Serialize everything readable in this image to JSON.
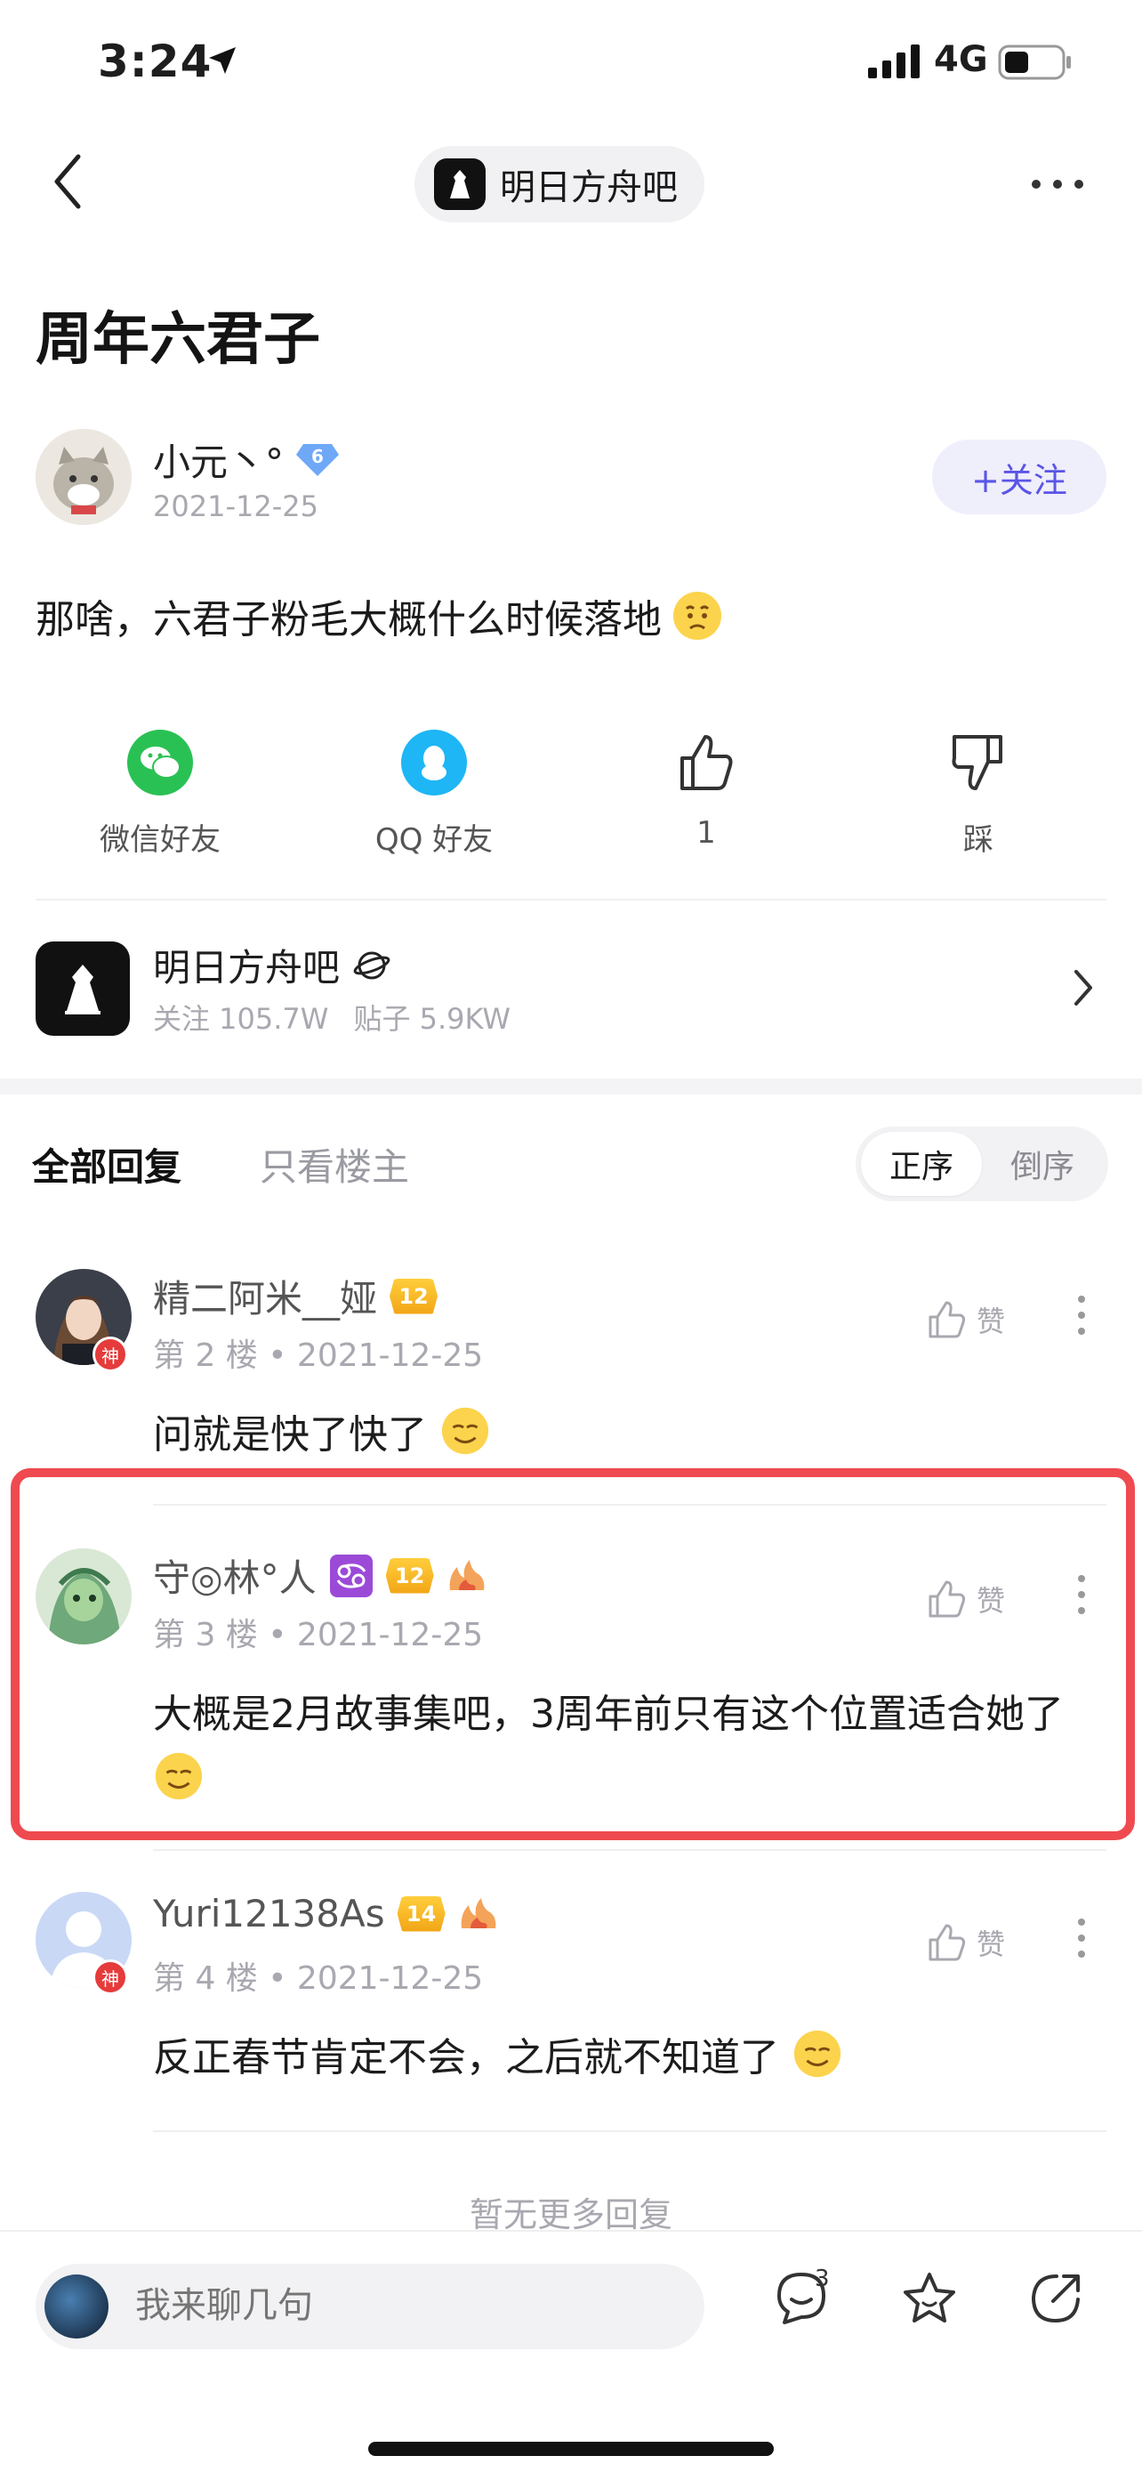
{
  "status_bar": {
    "time": "3:24",
    "network": "4G"
  },
  "nav": {
    "forum_name": "明日方舟吧"
  },
  "post": {
    "title": "周年六君子",
    "author": {
      "name": "小元丶°",
      "level": "6",
      "date": "2021-12-25"
    },
    "follow_label": "+关注",
    "body": "那啥，六君子粉毛大概什么时候落地"
  },
  "share": [
    {
      "label": "微信好友",
      "icon": "wechat-icon"
    },
    {
      "label": "QQ 好友",
      "icon": "qq-icon"
    },
    {
      "label": "1",
      "icon": "thumbs-up-icon"
    },
    {
      "label": "踩",
      "icon": "thumbs-down-icon"
    }
  ],
  "forum_card": {
    "name": "明日方舟吧",
    "followers": "关注 105.7W",
    "posts": "贴子 5.9KW"
  },
  "tabs": {
    "all": "全部回复",
    "op_only": "只看楼主"
  },
  "sort": {
    "asc": "正序",
    "desc": "倒序"
  },
  "replies": [
    {
      "name": "精二阿米__娅",
      "level": "12",
      "floor": "第 2 楼",
      "date": "2021-12-25",
      "text": "问就是快了快了",
      "like_label": "赞",
      "god": "神"
    },
    {
      "name": "守◎林°人",
      "level": "12",
      "floor": "第 3 楼",
      "date": "2021-12-25",
      "text": "大概是2月故事集吧，3周年前只有这个位置适合她了",
      "like_label": "赞"
    },
    {
      "name": "Yuri12138As",
      "level": "14",
      "floor": "第 4 楼",
      "date": "2021-12-25",
      "text": "反正春节肯定不会，之后就不知道了",
      "like_label": "赞",
      "god": "神"
    }
  ],
  "no_more": "暂无更多回复",
  "bottom_bar": {
    "placeholder": "我来聊几句",
    "comment_count": "3"
  },
  "colors": {
    "accent": "#5a55e6",
    "highlight": "#ef4a4f",
    "level_gold": "#f2a616",
    "wechat": "#2ac154",
    "qq": "#1eb6f5"
  }
}
